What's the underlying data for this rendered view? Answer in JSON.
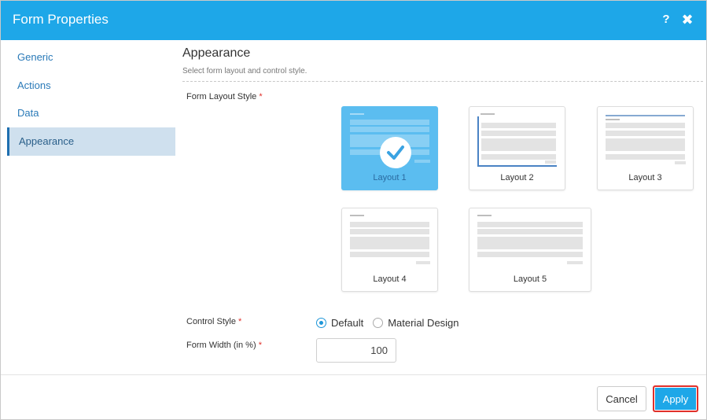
{
  "dialog": {
    "title": "Form Properties",
    "help_icon": "?",
    "close_icon": "✖"
  },
  "sidebar": {
    "items": [
      {
        "label": "Generic",
        "active": false
      },
      {
        "label": "Actions",
        "active": false
      },
      {
        "label": "Data",
        "active": false
      },
      {
        "label": "Appearance",
        "active": true
      }
    ]
  },
  "appearance": {
    "title": "Appearance",
    "subtitle": "Select form layout and control style.",
    "layout_style_label": "Form Layout Style",
    "required_mark": "*",
    "layouts": [
      {
        "label": "Layout 1",
        "selected": true
      },
      {
        "label": "Layout 2",
        "selected": false
      },
      {
        "label": "Layout 3",
        "selected": false
      },
      {
        "label": "Layout 4",
        "selected": false
      },
      {
        "label": "Layout 5",
        "selected": false
      }
    ],
    "control_style_label": "Control Style",
    "control_style_options": [
      {
        "label": "Default",
        "selected": true
      },
      {
        "label": "Material Design",
        "selected": false
      }
    ],
    "form_width_label": "Form Width (in %)",
    "form_width_value": "100"
  },
  "footer": {
    "cancel_label": "Cancel",
    "apply_label": "Apply"
  },
  "colors": {
    "accent": "#1ea7e8",
    "selected_card": "#5bbdf0",
    "required": "#e0302a",
    "active_nav_bg": "#cfe0ee"
  }
}
